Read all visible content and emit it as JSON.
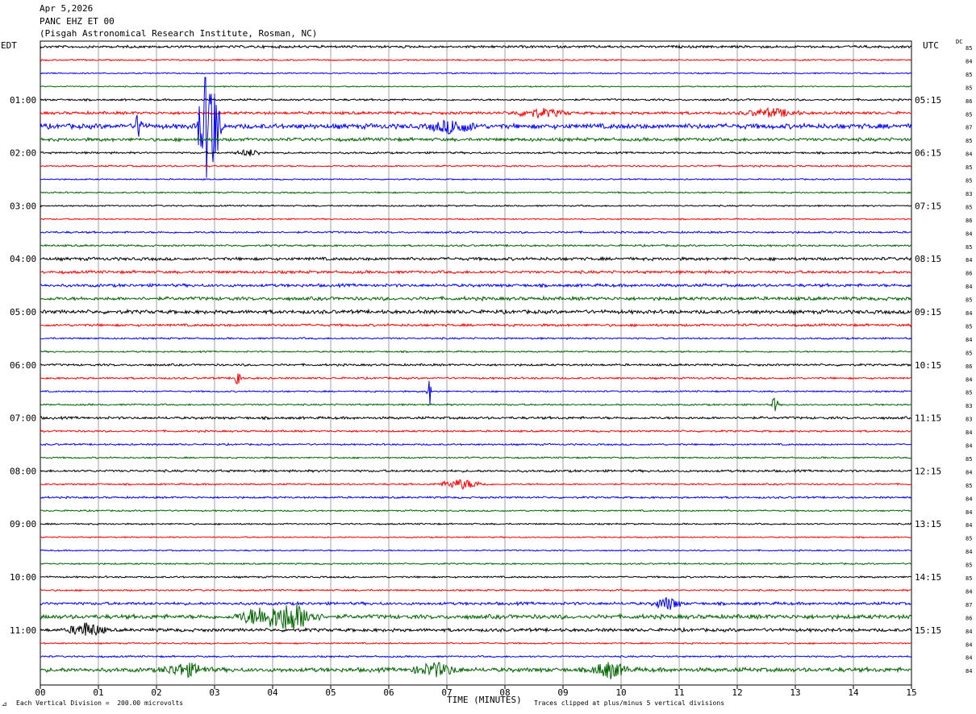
{
  "header": {
    "date": "Apr 5,2026",
    "station": "PANC EHZ ET 00",
    "institute": "(Pisgah Astronomical Research Institute, Rosman, NC)"
  },
  "left_tz": "EDT",
  "right_tz": "UTC",
  "dc_label": "DC",
  "footer": {
    "scale_note": "Each Vertical Division =  200.00 microvolts",
    "clip_note": "Traces clipped at plus/minus 5 vertical divisions",
    "corner_mark": "⊿"
  },
  "colors": {
    "black": "#000000",
    "red": "#ff0000",
    "blue": "#0000ff",
    "green": "#006600",
    "grid": "#a0a0a0"
  },
  "chart_data": {
    "type": "line",
    "title": "PANC EHZ ET 00",
    "xlabel": "TIME (MINUTES)",
    "xlim": [
      0,
      15
    ],
    "x_ticks": [
      "00",
      "01",
      "02",
      "03",
      "04",
      "05",
      "06",
      "07",
      "08",
      "09",
      "10",
      "11",
      "12",
      "13",
      "14",
      "15"
    ],
    "trace_color_cycle": [
      "black",
      "red",
      "blue",
      "green"
    ],
    "left_hour_labels": [
      "01:00",
      "02:00",
      "03:00",
      "04:00",
      "05:00",
      "06:00",
      "07:00",
      "08:00",
      "09:00",
      "10:00",
      "11:00"
    ],
    "right_hour_labels": [
      "05:15",
      "06:15",
      "07:15",
      "08:15",
      "09:15",
      "10:15",
      "11:15",
      "12:15",
      "13:15",
      "14:15",
      "15:15"
    ],
    "dc_offsets": [
      "85",
      "84",
      "85",
      "85",
      "86",
      "85",
      "87",
      "85",
      "84",
      "85",
      "85",
      "83",
      "85",
      "86",
      "84",
      "85",
      "84",
      "86",
      "84",
      "85",
      "84",
      "85",
      "84",
      "85",
      "86",
      "84",
      "85",
      "83",
      "83",
      "84",
      "84",
      "85",
      "84",
      "85",
      "84",
      "84",
      "84",
      "85",
      "84",
      "85",
      "85",
      "84",
      "87",
      "86",
      "84",
      "84",
      "84",
      "84"
    ],
    "noise_levels": [
      1.3,
      0.8,
      0.7,
      0.6,
      1.0,
      1.5,
      2.6,
      1.7,
      1.0,
      0.9,
      0.7,
      0.8,
      0.8,
      0.7,
      1.0,
      1.0,
      1.6,
      1.5,
      1.6,
      1.8,
      1.9,
      1.3,
      0.9,
      0.8,
      1.1,
      1.0,
      0.8,
      0.9,
      1.3,
      1.0,
      0.9,
      0.8,
      1.2,
      0.9,
      1.0,
      0.8,
      0.8,
      0.7,
      0.7,
      0.8,
      0.9,
      0.9,
      1.5,
      2.2,
      1.7,
      0.8,
      0.9,
      2.2
    ],
    "events": [
      {
        "trace": 6,
        "minute": 2.9,
        "amplitude": 82,
        "duration_min": 0.25,
        "note": "clipped"
      },
      {
        "trace": 6,
        "minute": 1.7,
        "amplitude": 18,
        "duration_min": 0.1
      },
      {
        "trace": 5,
        "minute": 8.6,
        "amplitude": 5,
        "duration_min": 0.6
      },
      {
        "trace": 5,
        "minute": 12.6,
        "amplitude": 5,
        "duration_min": 0.6
      },
      {
        "trace": 6,
        "minute": 7.1,
        "amplitude": 8,
        "duration_min": 0.5
      },
      {
        "trace": 8,
        "minute": 3.6,
        "amplitude": 4,
        "duration_min": 0.3
      },
      {
        "trace": 25,
        "minute": 3.4,
        "amplitude": 16,
        "duration_min": 0.08
      },
      {
        "trace": 26,
        "minute": 6.7,
        "amplitude": 18,
        "duration_min": 0.06
      },
      {
        "trace": 27,
        "minute": 12.65,
        "amplitude": 16,
        "duration_min": 0.06
      },
      {
        "trace": 33,
        "minute": 7.25,
        "amplitude": 6,
        "duration_min": 0.5
      },
      {
        "trace": 42,
        "minute": 10.8,
        "amplitude": 8,
        "duration_min": 0.3
      },
      {
        "trace": 43,
        "minute": 4.3,
        "amplitude": 18,
        "duration_min": 0.6
      },
      {
        "trace": 43,
        "minute": 3.7,
        "amplitude": 10,
        "duration_min": 0.4
      },
      {
        "trace": 44,
        "minute": 0.8,
        "amplitude": 9,
        "duration_min": 0.4
      },
      {
        "trace": 47,
        "minute": 9.8,
        "amplitude": 10,
        "duration_min": 0.4
      },
      {
        "trace": 47,
        "minute": 2.5,
        "amplitude": 8,
        "duration_min": 0.5
      },
      {
        "trace": 47,
        "minute": 6.8,
        "amplitude": 8,
        "duration_min": 0.5
      }
    ]
  }
}
